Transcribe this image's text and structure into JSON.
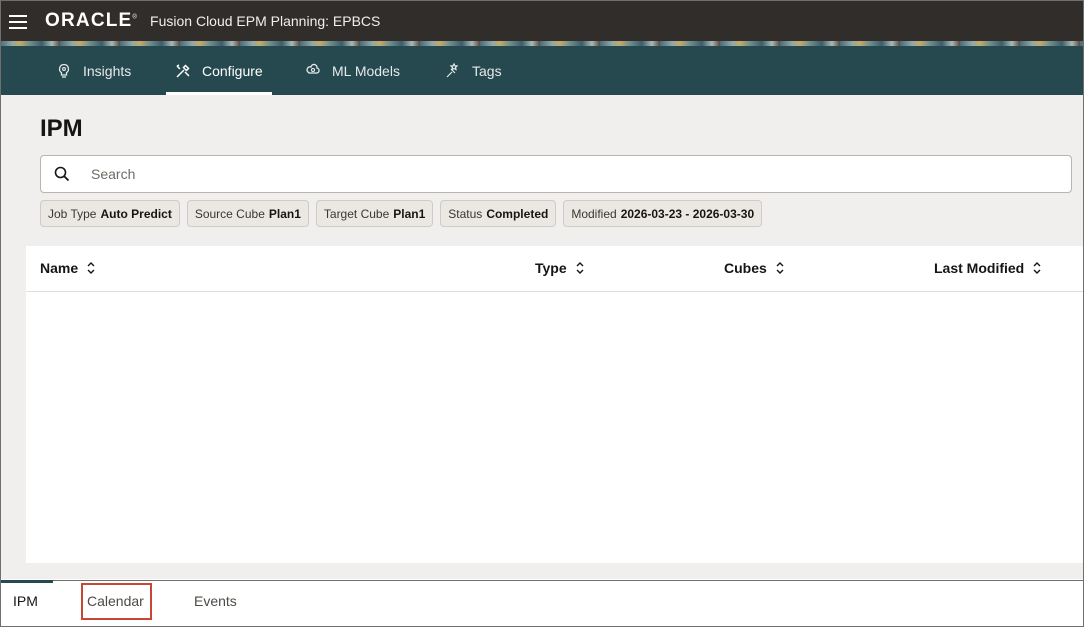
{
  "header": {
    "logo": "ORACLE",
    "logo_mark": "®",
    "title": "Fusion Cloud EPM Planning:  EPBCS"
  },
  "nav": {
    "tabs": [
      {
        "label": "Insights",
        "icon": "insights-icon"
      },
      {
        "label": "Configure",
        "icon": "configure-icon",
        "active": true
      },
      {
        "label": "ML Models",
        "icon": "ml-models-icon"
      },
      {
        "label": "Tags",
        "icon": "tags-icon"
      }
    ]
  },
  "page": {
    "title": "IPM",
    "search_placeholder": "Search",
    "filters": [
      {
        "key": "Job Type",
        "value": "Auto Predict"
      },
      {
        "key": "Source Cube",
        "value": "Plan1"
      },
      {
        "key": "Target Cube",
        "value": "Plan1"
      },
      {
        "key": "Status",
        "value": "Completed"
      },
      {
        "key": "Modified",
        "value": "2026-03-23 - 2026-03-30"
      }
    ]
  },
  "table": {
    "columns": [
      "Name",
      "Type",
      "Cubes",
      "Last Modified"
    ],
    "rows": []
  },
  "bottom_tabs": [
    {
      "label": "IPM",
      "active": true
    },
    {
      "label": "Calendar",
      "highlighted": true
    },
    {
      "label": "Events"
    }
  ],
  "colors": {
    "header_bg": "#312d2a",
    "nav_bg": "#26484f",
    "page_bg": "#f1efed",
    "highlight": "#c74634"
  }
}
